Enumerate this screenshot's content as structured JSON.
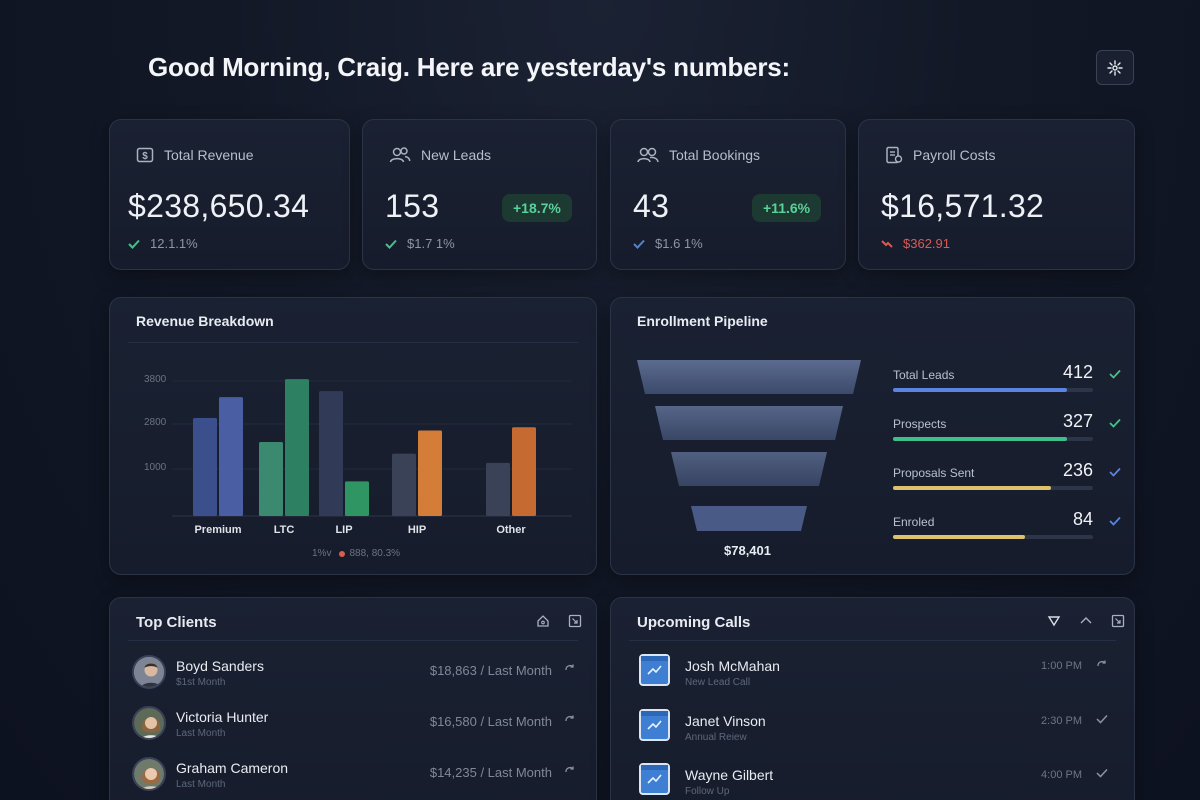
{
  "header": {
    "greeting": "Good Morning, Craig. Here are yesterday's numbers:",
    "settings_icon": "sparkle-settings-icon"
  },
  "kpis": [
    {
      "label": "Total Revenue",
      "value": "$238,650.34",
      "sub": "12.1.1%",
      "badge": "",
      "icon": "dollar-icon",
      "trend": "up"
    },
    {
      "label": "New Leads",
      "value": "153",
      "sub": "$1.7 1%",
      "badge": "+18.7%",
      "icon": "users-icon",
      "trend": "up"
    },
    {
      "label": "Total Bookings",
      "value": "43",
      "sub": "$1.6 1%",
      "badge": "+11.6%",
      "icon": "users-icon",
      "trend": "up"
    },
    {
      "label": "Payroll Costs",
      "value": "$16,571.32",
      "sub": "$362.91",
      "badge": "",
      "icon": "payroll-icon",
      "trend": "down"
    }
  ],
  "revenue_breakdown": {
    "title": "Revenue Breakdown",
    "footer": "1%v",
    "footer2": "888, 80.3%"
  },
  "chart_data": {
    "type": "bar",
    "categories": [
      "Premium",
      "LTC",
      "LIP",
      "HIP",
      "Other"
    ],
    "yticks": [
      "3800",
      "2800",
      "1000"
    ],
    "series": [
      {
        "values": [
          2120,
          1600,
          2700,
          1350,
          1150
        ]
      },
      {
        "values": [
          2570,
          2960,
          750,
          1850,
          1920
        ]
      }
    ],
    "colors": [
      [
        "#3c4f8d",
        "#4a5fa3"
      ],
      [
        "#3b8a6f",
        "#2e8063"
      ],
      [
        "#313b58",
        "#2f9663"
      ],
      [
        "#3a4258",
        "#d37d39"
      ],
      [
        "#3a4258",
        "#c56a30"
      ]
    ]
  },
  "pipeline": {
    "title": "Enrollment Pipeline",
    "funnel_total": "$78,401",
    "stages": [
      {
        "label": "Total Leads",
        "value": "412",
        "fraction": 0.87,
        "color": "#5b84e0"
      },
      {
        "label": "Prospects",
        "value": "327",
        "fraction": 0.87,
        "color": "#3fbf8b"
      },
      {
        "label": "Proposals Sent",
        "value": "236",
        "fraction": 0.79,
        "color": "#e0c06a"
      },
      {
        "label": "Enroled",
        "value": "84",
        "fraction": 0.66,
        "color": "#e0c06a"
      }
    ]
  },
  "top_clients": {
    "title": "Top Clients",
    "rows": [
      {
        "name": "Boyd Sanders",
        "sub": "$1st Month",
        "amount": "$18,863 / Last Month"
      },
      {
        "name": "Victoria Hunter",
        "sub": "Last Month",
        "amount": "$16,580 / Last Month"
      },
      {
        "name": "Graham Cameron",
        "sub": "Last Month",
        "amount": "$14,235 / Last Month"
      }
    ]
  },
  "upcoming_calls": {
    "title": "Upcoming Calls",
    "rows": [
      {
        "name": "Josh McMahan",
        "sub": "New Lead Call",
        "time": "1:00 PM"
      },
      {
        "name": "Janet Vinson",
        "sub": "Annual Reiew",
        "time": "2:30 PM"
      },
      {
        "name": "Wayne Gilbert",
        "sub": "Follow Up",
        "time": "4:00 PM"
      }
    ]
  }
}
